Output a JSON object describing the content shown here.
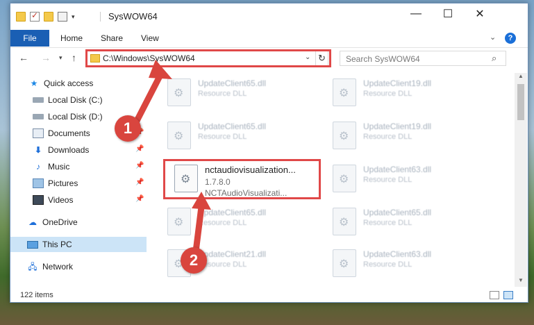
{
  "window": {
    "title": "SysWOW64",
    "controls": {
      "minimize": "—",
      "maximize": "☐",
      "close": "✕"
    }
  },
  "ribbon": {
    "tabs": [
      "File",
      "Home",
      "Share",
      "View"
    ],
    "help": "?"
  },
  "nav": {
    "address": "C:\\Windows\\SysWOW64",
    "search_placeholder": "Search SysWOW64"
  },
  "sidebar": {
    "items": [
      {
        "label": "Quick access",
        "icon": "star-icon",
        "pinned": false
      },
      {
        "label": "Local Disk (C:)",
        "icon": "disk-icon",
        "pinned": true
      },
      {
        "label": "Local Disk (D:)",
        "icon": "disk-icon",
        "pinned": true
      },
      {
        "label": "Documents",
        "icon": "documents-icon",
        "pinned": true
      },
      {
        "label": "Downloads",
        "icon": "downloads-icon",
        "pinned": true
      },
      {
        "label": "Music",
        "icon": "music-icon",
        "pinned": true
      },
      {
        "label": "Pictures",
        "icon": "pictures-icon",
        "pinned": true
      },
      {
        "label": "Videos",
        "icon": "videos-icon",
        "pinned": true
      },
      {
        "label": "OneDrive",
        "icon": "onedrive-icon",
        "pinned": false
      },
      {
        "label": "This PC",
        "icon": "this-pc-icon",
        "pinned": false,
        "selected": true
      },
      {
        "label": "Network",
        "icon": "network-icon",
        "pinned": false
      }
    ]
  },
  "files": {
    "left": [
      {
        "name": "UpdateClient65.dll",
        "desc": "Resource DLL"
      },
      {
        "name": "UpdateClient65.dll",
        "desc": "Resource DLL"
      },
      {
        "name": "nctaudiovisualization...",
        "version": "1.7.8.0",
        "desc": "NCTAudioVisualizati..."
      },
      {
        "name": "UpdateClient65.dll",
        "desc": "Resource DLL"
      },
      {
        "name": "UpdateClient21.dll",
        "desc": "Resource DLL"
      }
    ],
    "right": [
      {
        "name": "UpdateClient19.dll",
        "desc": "Resource DLL"
      },
      {
        "name": "UpdateClient19.dll",
        "desc": "Resource DLL"
      },
      {
        "name": "UpdateClient63.dll",
        "desc": "Resource DLL"
      },
      {
        "name": "UpdateClient65.dll",
        "desc": "Resource DLL"
      },
      {
        "name": "UpdateClient63.dll",
        "desc": "Resource DLL"
      }
    ]
  },
  "status": {
    "items_count": "122 items"
  },
  "callouts": {
    "one": "1",
    "two": "2"
  },
  "colors": {
    "accent": "#1a5fb4",
    "highlight": "#e04848",
    "selected": "#cce4f7"
  }
}
